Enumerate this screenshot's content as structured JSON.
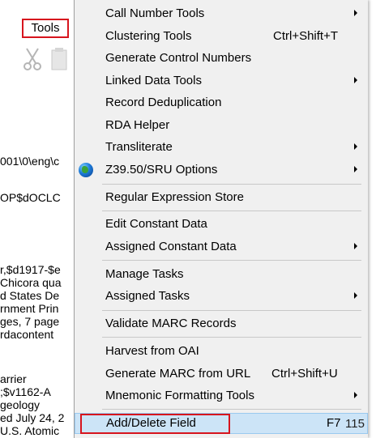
{
  "menubar": {
    "tools_label": "Tools"
  },
  "background_text": {
    "line1": "001\\0\\eng\\c",
    "line2": "OP$dOCLC",
    "lines3": [
      "r,$d1917-$e",
      "Chicora qua",
      "d States De",
      "rnment Prin",
      "ges, 7 page",
      "rdacontent"
    ],
    "lines4": [
      "arrier",
      ";$v1162-A",
      "geology",
      "ed July 24, 2",
      "U.S. Atomic"
    ]
  },
  "menu": {
    "items": [
      {
        "label": "Call Number Tools",
        "submenu": true
      },
      {
        "label": "Clustering Tools",
        "shortcut": "Ctrl+Shift+T"
      },
      {
        "label": "Generate Control Numbers"
      },
      {
        "label": "Linked Data Tools",
        "submenu": true
      },
      {
        "label": "Record Deduplication"
      },
      {
        "label": "RDA Helper"
      },
      {
        "label": "Transliterate",
        "submenu": true
      },
      {
        "label": "Z39.50/SRU Options",
        "submenu": true,
        "icon": "globe-icon"
      },
      {
        "label": "Regular Expression Store"
      },
      {
        "label": "Edit Constant Data"
      },
      {
        "label": "Assigned Constant Data",
        "submenu": true
      },
      {
        "label": "Manage Tasks"
      },
      {
        "label": "Assigned Tasks",
        "submenu": true
      },
      {
        "label": "Validate MARC Records"
      },
      {
        "label": "Harvest from OAI"
      },
      {
        "label": "Generate MARC from URL",
        "shortcut": "Ctrl+Shift+U"
      },
      {
        "label": "Mnemonic Formatting Tools",
        "submenu": true
      },
      {
        "label": "Add/Delete Field",
        "shortcut": "F7",
        "highlighted": true
      }
    ]
  },
  "page_number": "115",
  "colors": {
    "annotation_red": "#d7141d",
    "menu_bg": "#f0f0f0",
    "highlight": "#cce4f7"
  }
}
